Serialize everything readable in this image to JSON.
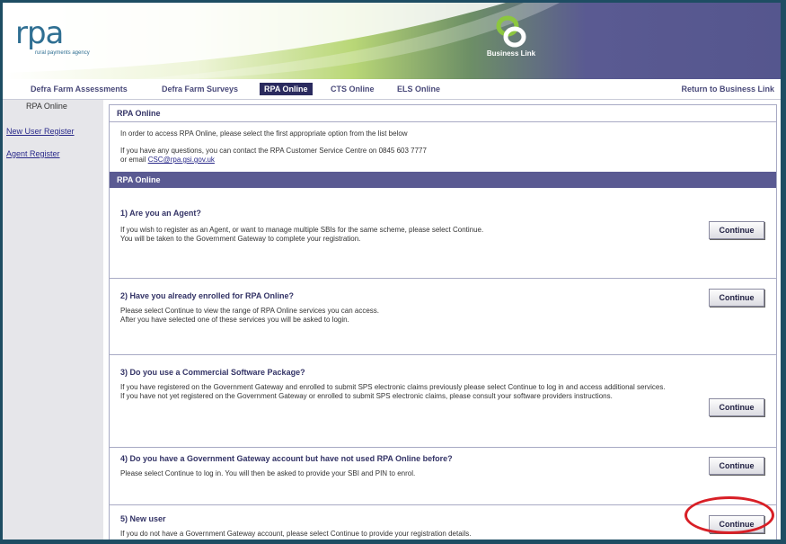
{
  "header": {
    "logo_text": "rpa",
    "logo_subtitle": "rural payments agency",
    "business_link_logo": "Business Link",
    "brand_colors": {
      "teal": "#2f6f92",
      "purple": "#5a5a92",
      "green": "#8cc63f",
      "nav_active": "#2a2a5e",
      "highlight_oval": "#d81f26"
    }
  },
  "nav": {
    "items": [
      "Defra Farm Assessments",
      "Defra Farm Surveys",
      "RPA Online",
      "CTS Online",
      "ELS Online"
    ],
    "active": "RPA Online",
    "return_link": "Return to Business Link"
  },
  "sidebar": {
    "caption": "RPA Online",
    "links": [
      "New User Register",
      "Agent Register"
    ]
  },
  "main": {
    "heading": "RPA Online",
    "intro_line": "In order to access RPA Online, please select the first appropriate option from the list below",
    "contact_line1": "If you have any questions, you can contact the RPA Customer Service Centre on 0845 603 7777",
    "contact_line2_prefix": "or email",
    "contact_email": "CSC@rpa.gsi.gov.uk",
    "section_bar": "RPA Online",
    "sections": [
      {
        "title": "1) Are you an Agent?",
        "lines": [
          "If you wish to register as an Agent, or want to manage multiple SBIs for the same scheme, please select Continue.",
          "You will be taken to the Government Gateway to complete your registration."
        ],
        "button": "Continue"
      },
      {
        "title": "2) Have you already enrolled for RPA Online?",
        "lines": [
          "Please select Continue to view the range of RPA Online services you can access.",
          "After you have selected one of these services you will be asked to login."
        ],
        "button": "Continue"
      },
      {
        "title": "3) Do you use a Commercial Software Package?",
        "lines": [
          "If you have registered on the Government Gateway and enrolled to submit SPS electronic claims previously please select Continue to log in and access additional services.",
          "If you have not yet registered on the Government Gateway or enrolled to submit SPS electronic claims, please consult your software providers instructions."
        ],
        "button": "Continue"
      },
      {
        "title": "4) Do you have a Government Gateway account but have not used RPA Online before?",
        "lines": [
          "Please select Continue to log in. You will then be asked to provide your SBI and PIN to enrol."
        ],
        "button": "Continue"
      },
      {
        "title": "5) New user",
        "lines": [
          "If you do not have a Government Gateway account, please select Continue to provide your registration details."
        ],
        "button": "Continue"
      }
    ]
  }
}
